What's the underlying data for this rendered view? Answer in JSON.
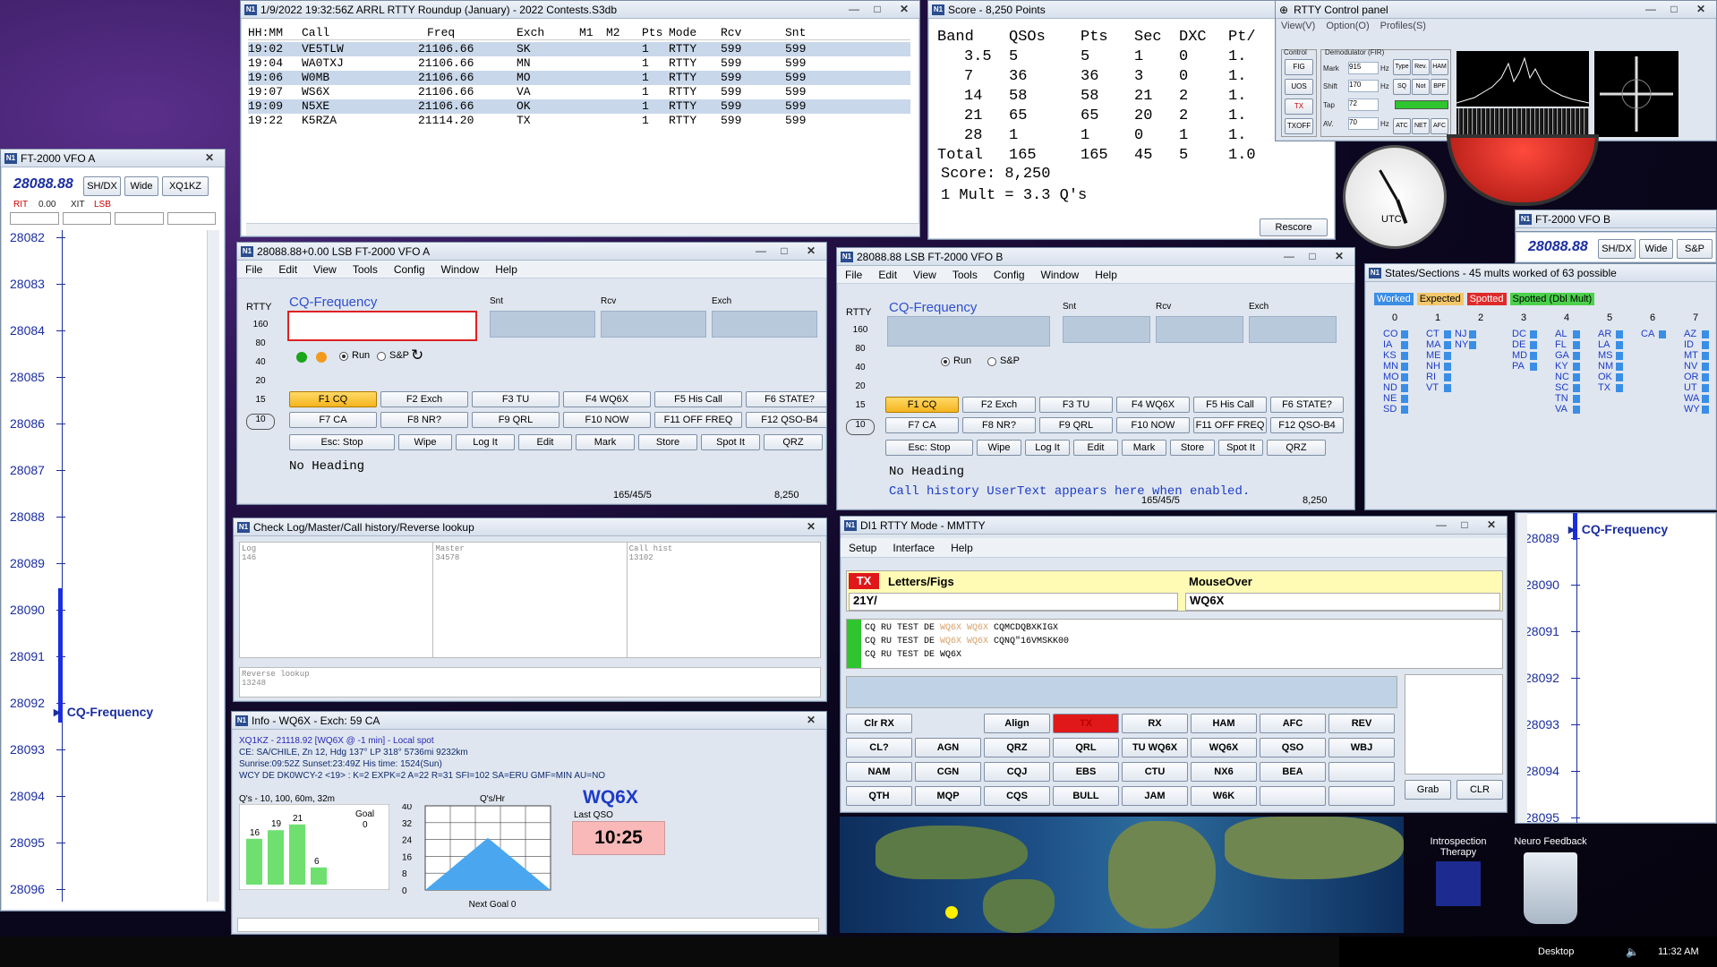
{
  "colors": {
    "accent": "#2f4fcf",
    "yellow_btn": "#f5b51f",
    "tx_red": "#e0181a",
    "green": "#2ec52e"
  },
  "log": {
    "title": "1/9/2022 19:32:56Z  ARRL RTTY Roundup (January) - 2022 Contests.S3db",
    "headers": [
      "HH:MM",
      "Call",
      "Freq",
      "Exch",
      "M1",
      "M2",
      "Pts",
      "Mode",
      "Rcv",
      "Snt"
    ],
    "rows": [
      [
        "19:02",
        "VE5TLW",
        "21106.66",
        "SK",
        "",
        "",
        "1",
        "RTTY",
        "599",
        "599"
      ],
      [
        "19:04",
        "WA0TXJ",
        "21106.66",
        "MN",
        "",
        "",
        "1",
        "RTTY",
        "599",
        "599"
      ],
      [
        "19:06",
        "W0MB",
        "21106.66",
        "MO",
        "",
        "",
        "1",
        "RTTY",
        "599",
        "599"
      ],
      [
        "19:07",
        "WS6X",
        "21106.66",
        "VA",
        "",
        "",
        "1",
        "RTTY",
        "599",
        "599"
      ],
      [
        "19:09",
        "N5XE",
        "21106.66",
        "OK",
        "",
        "",
        "1",
        "RTTY",
        "599",
        "599"
      ],
      [
        "19:22",
        "K5RZA",
        "21114.20",
        "TX",
        "",
        "",
        "1",
        "RTTY",
        "599",
        "599"
      ]
    ]
  },
  "score": {
    "title": "Score - 8,250 Points",
    "headers": [
      "Band",
      "QSOs",
      "Pts",
      "Sec",
      "DXC",
      "Pt/"
    ],
    "rows": [
      [
        "3.5",
        "5",
        "5",
        "1",
        "0",
        "1."
      ],
      [
        "7",
        "36",
        "36",
        "3",
        "0",
        "1."
      ],
      [
        "14",
        "58",
        "58",
        "21",
        "2",
        "1."
      ],
      [
        "21",
        "65",
        "65",
        "20",
        "2",
        "1."
      ],
      [
        "28",
        "1",
        "1",
        "0",
        "1",
        "1."
      ],
      [
        "Total",
        "165",
        "165",
        "45",
        "5",
        "1.0"
      ]
    ],
    "line1": "Score: 8,250",
    "line2": "1 Mult = 3.3 Q's",
    "rescore": "Rescore"
  },
  "rttycp": {
    "title": "RTTY Control panel",
    "menu": [
      "View(V)",
      "Option(O)",
      "Profiles(S)"
    ],
    "control": "Control",
    "demod": "Demodulator (FIR)",
    "btns": [
      "FIG",
      "UOS",
      "TX",
      "TXOFF"
    ],
    "mark": "Mark",
    "mark_val": "915",
    "shift": "Shift",
    "shift_val": "170",
    "tap": "Tap",
    "tap_val": "72",
    "av": "AV.",
    "av_val": "70",
    "hz": "Hz",
    "type": "Type",
    "rev": "Rev.",
    "ham": "HAM",
    "sq": "SQ",
    "net": "NET",
    "atc": "ATC",
    "bpf": "BPF",
    "afc": "AFC",
    "not": "Not"
  },
  "vfoa": {
    "title": "FT-2000 VFO A",
    "freq": "28088.88",
    "buttons": [
      "SH/DX",
      "Wide",
      "XQ1KZ"
    ],
    "rit": "RIT",
    "rit_val": "0.00",
    "xit": "XIT",
    "mode": "LSB",
    "ticks": [
      "28082",
      "28083",
      "28084",
      "28085",
      "28086",
      "28087",
      "28088",
      "28089",
      "28090",
      "28091",
      "28092",
      "28093",
      "28094",
      "28095",
      "28096"
    ],
    "marker": "CQ-Frequency"
  },
  "vfob": {
    "title": "FT-2000 VFO B",
    "freq": "28088.88",
    "buttons": [
      "SH/DX",
      "Wide",
      "S&P"
    ],
    "ticks": [
      "28089",
      "28090",
      "28091",
      "28092",
      "28093",
      "28094",
      "28095"
    ],
    "marker": "CQ-Frequency"
  },
  "entrya": {
    "title": "28088.88+0.00 LSB FT-2000 VFO A",
    "menu": [
      "File",
      "Edit",
      "View",
      "Tools",
      "Config",
      "Window",
      "Help"
    ],
    "mode": "RTTY",
    "bands": [
      "160",
      "80",
      "40",
      "20",
      "15",
      "10"
    ],
    "callLabel": "CQ-Frequency",
    "snt": "Snt",
    "rcv": "Rcv",
    "exch": "Exch",
    "run": "Run",
    "sp": "S&P",
    "fkeys": [
      "F1 CQ",
      "F2 Exch",
      "F3 TU",
      "F4 WQ6X",
      "F5 His Call",
      "F6 STATE?",
      "F7 CA",
      "F8 NR?",
      "F9 QRL",
      "F10 NOW",
      "F11 OFF FREQ",
      "F12 QSO-B4"
    ],
    "ctrl": [
      "Esc: Stop",
      "Wipe",
      "Log It",
      "Edit",
      "Mark",
      "Store",
      "Spot It",
      "QRZ"
    ],
    "heading": "No Heading",
    "status": "165/45/5",
    "score": "8,250"
  },
  "entryb": {
    "title": "28088.88 LSB FT-2000 VFO B",
    "menu": [
      "File",
      "Edit",
      "View",
      "Tools",
      "Config",
      "Window",
      "Help"
    ],
    "mode": "RTTY",
    "bands": [
      "160",
      "80",
      "40",
      "20",
      "15",
      "10"
    ],
    "callLabel": "CQ-Frequency",
    "snt": "Snt",
    "rcv": "Rcv",
    "exch": "Exch",
    "run": "Run",
    "sp": "S&P",
    "fkeys": [
      "F1 CQ",
      "F2 Exch",
      "F3 TU",
      "F4 WQ6X",
      "F5 His Call",
      "F6 STATE?",
      "F7 CA",
      "F8 NR?",
      "F9 QRL",
      "F10 NOW",
      "F11 OFF FREQ",
      "F12 QSO-B4"
    ],
    "ctrl": [
      "Esc: Stop",
      "Wipe",
      "Log It",
      "Edit",
      "Mark",
      "Store",
      "Spot It",
      "QRZ"
    ],
    "heading": "No Heading",
    "note": "Call history UserText appears here when enabled.",
    "status": "165/45/5",
    "score": "8,250"
  },
  "check": {
    "title": "Check Log/Master/Call history/Reverse lookup",
    "log": "Log",
    "log_n": "146",
    "master": "Master",
    "master_n": "34578",
    "callhist": "Call hist",
    "callhist_n": "13102",
    "rev": "Reverse lookup",
    "rev_n": "13248"
  },
  "info": {
    "title": "Info - WQ6X - Exch: 59 CA",
    "l1": "XQ1KZ - 21118.92 [WQ6X @ -1 min] -  Local spot",
    "l2": "CE: SA/CHILE, Zn 12, Hdg 137° LP 318° 5736mi 9232km",
    "l3": "Sunrise:09:52Z Sunset:23:49Z His time: 1524(Sun)",
    "l4": "WCY DE DK0WCY-2 <19> : K=2 EXPK=2 A=22 R=31 SFI=102 SA=ERU GMF=MIN AU=NO",
    "call": "WQ6X",
    "lastqso": "Last QSO",
    "lastqso_t": "10:25",
    "qs_title": "Q's - 10, 100, 60m, 32m",
    "goal": "Goal",
    "goal_v": "0",
    "rate_title": "Q's/Hr",
    "next_goal": "Next Goal 0",
    "bars": [
      16,
      19,
      21,
      6
    ],
    "rate_ticks": [
      "40",
      "32",
      "24",
      "16",
      "8",
      "0"
    ]
  },
  "states": {
    "title": "States/Sections - 45 mults worked of 63 possible",
    "legend": [
      "Worked",
      "Expected",
      "Spotted",
      "Spotted (Dbl Mult)"
    ],
    "cols": [
      {
        "n": "0",
        "items": [
          "CO",
          "IA",
          "KS",
          "MN",
          "MO",
          "ND",
          "NE",
          "SD"
        ]
      },
      {
        "n": "1",
        "items": [
          "CT",
          "MA",
          "ME",
          "NH",
          "RI",
          "VT"
        ],
        "items2": [
          "NJ",
          "NY"
        ]
      },
      {
        "n": "2",
        "items": []
      },
      {
        "n": "3",
        "items": [
          "DC",
          "DE",
          "MD",
          "PA"
        ]
      },
      {
        "n": "4",
        "items": [
          "AL",
          "FL",
          "GA",
          "KY",
          "NC",
          "SC",
          "TN",
          "VA"
        ]
      },
      {
        "n": "5",
        "items": [
          "AR",
          "LA",
          "MS",
          "NM",
          "OK",
          "TX"
        ]
      },
      {
        "n": "6",
        "items": [
          "CA"
        ]
      },
      {
        "n": "7",
        "items": [
          "AZ",
          "ID",
          "MT",
          "NV",
          "OR",
          "UT",
          "WA",
          "WY"
        ]
      }
    ]
  },
  "mmtty": {
    "title": "DI1 RTTY Mode - MMTTY",
    "menu": [
      "Setup",
      "Interface",
      "Help"
    ],
    "tx": "TX",
    "lettersfigs": "Letters/Figs",
    "mouseover": "MouseOver",
    "lf_val": "21Y/",
    "mo_val": "WQ6X",
    "rx_lines": [
      [
        "CQ RU TEST DE ",
        "WQ6X WQ6X",
        " CQMCDQBXKIGX"
      ],
      [
        "CQ RU TEST DE ",
        "WQ6X WQ6X",
        " CQNQ\"16VMSKK00"
      ],
      [
        "CQ RU TEST DE WQ6X",
        "",
        ""
      ]
    ],
    "row1": [
      "Clr RX",
      "",
      "Align",
      "TX",
      "RX",
      "HAM",
      "AFC",
      "REV"
    ],
    "row2": [
      "CL?",
      "AGN",
      "QRZ",
      "QRL",
      "TU WQ6X",
      "WQ6X",
      "QSO",
      "WBJ"
    ],
    "row3": [
      "NAM",
      "CGN",
      "CQJ",
      "EBS",
      "CTU",
      "NX6",
      "BEA",
      ""
    ],
    "row4": [
      "QTH",
      "MQP",
      "CQS",
      "BULL",
      "JAM",
      "W6K",
      "",
      ""
    ],
    "grab": "Grab",
    "clr": "CLR"
  },
  "desktop": {
    "icon1": "Introspection Therapy",
    "icon2": "Neuro Feedback",
    "taskbar_desktop": "Desktop",
    "time": "11:32 AM"
  },
  "clock": {
    "label": "UTC"
  }
}
